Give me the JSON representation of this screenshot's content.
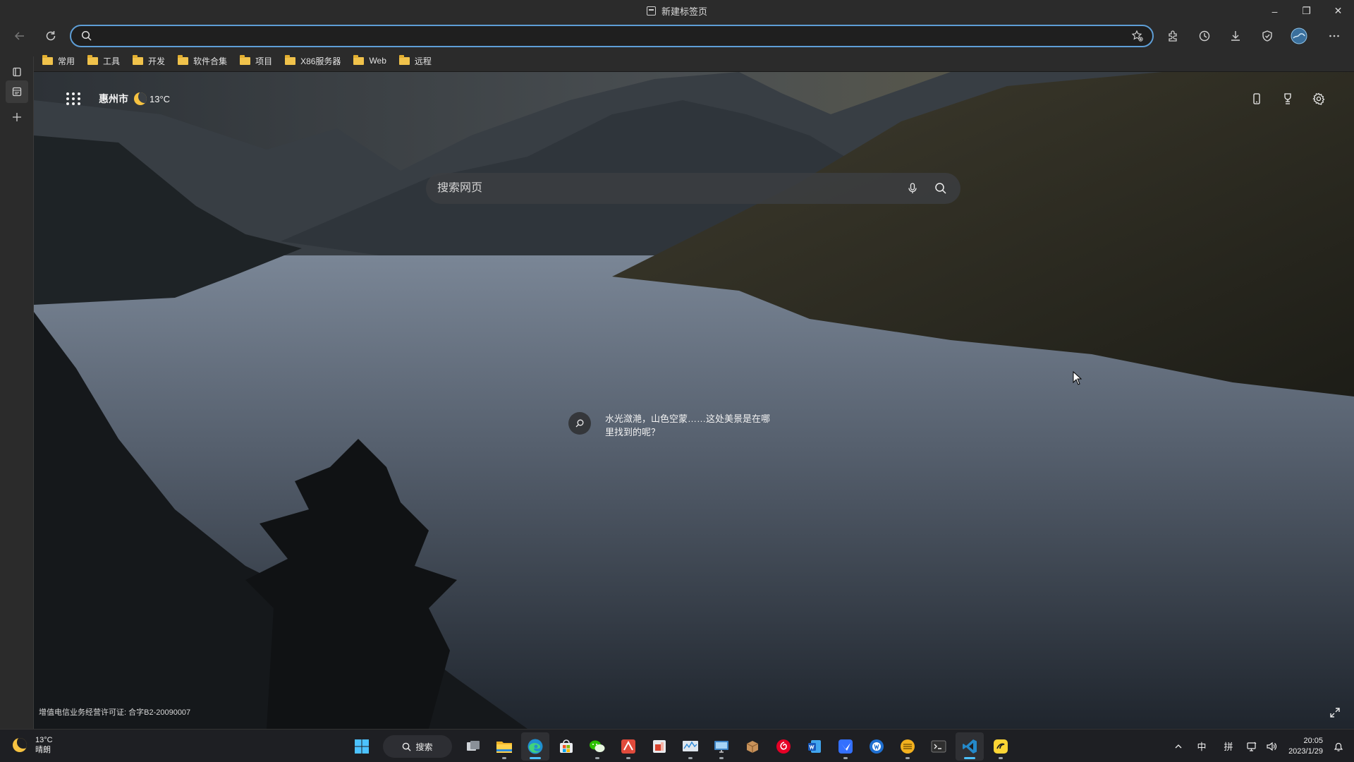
{
  "window": {
    "tab_title": "新建标签页",
    "minimize": "–",
    "restore": "❐",
    "close": "✕"
  },
  "toolbar": {
    "address_value": "",
    "icons": [
      "back-icon",
      "refresh-icon",
      "search-icon",
      "favorite-star-icon",
      "extensions-icon",
      "history-icon",
      "download-icon",
      "browser-essentials-icon",
      "profile-avatar",
      "more-icon"
    ]
  },
  "bookmarks": [
    {
      "label": "常用"
    },
    {
      "label": "工具"
    },
    {
      "label": "开发"
    },
    {
      "label": "软件合集"
    },
    {
      "label": "项目"
    },
    {
      "label": "X86服务器"
    },
    {
      "label": "Web"
    },
    {
      "label": "远程"
    }
  ],
  "newtab": {
    "city": "惠州市",
    "temperature": "13°C",
    "search_placeholder": "搜索网页",
    "caption_line1": "水光潋滟，山色空蒙……这处美景是在哪",
    "caption_line2": "里找到的呢？",
    "license": "增值电信业务经营许可证: 合字B2-20090007"
  },
  "taskbar": {
    "weather_temp": "13°C",
    "weather_desc": "晴朗",
    "search_label": "搜索",
    "ime_lang": "中",
    "ime_mode": "拼",
    "time": "20:05",
    "date": "2023/1/29"
  },
  "colors": {
    "accent": "#5e9ed6",
    "folder": "#f0c24b",
    "taskbar_active": "#4cc2ff"
  }
}
